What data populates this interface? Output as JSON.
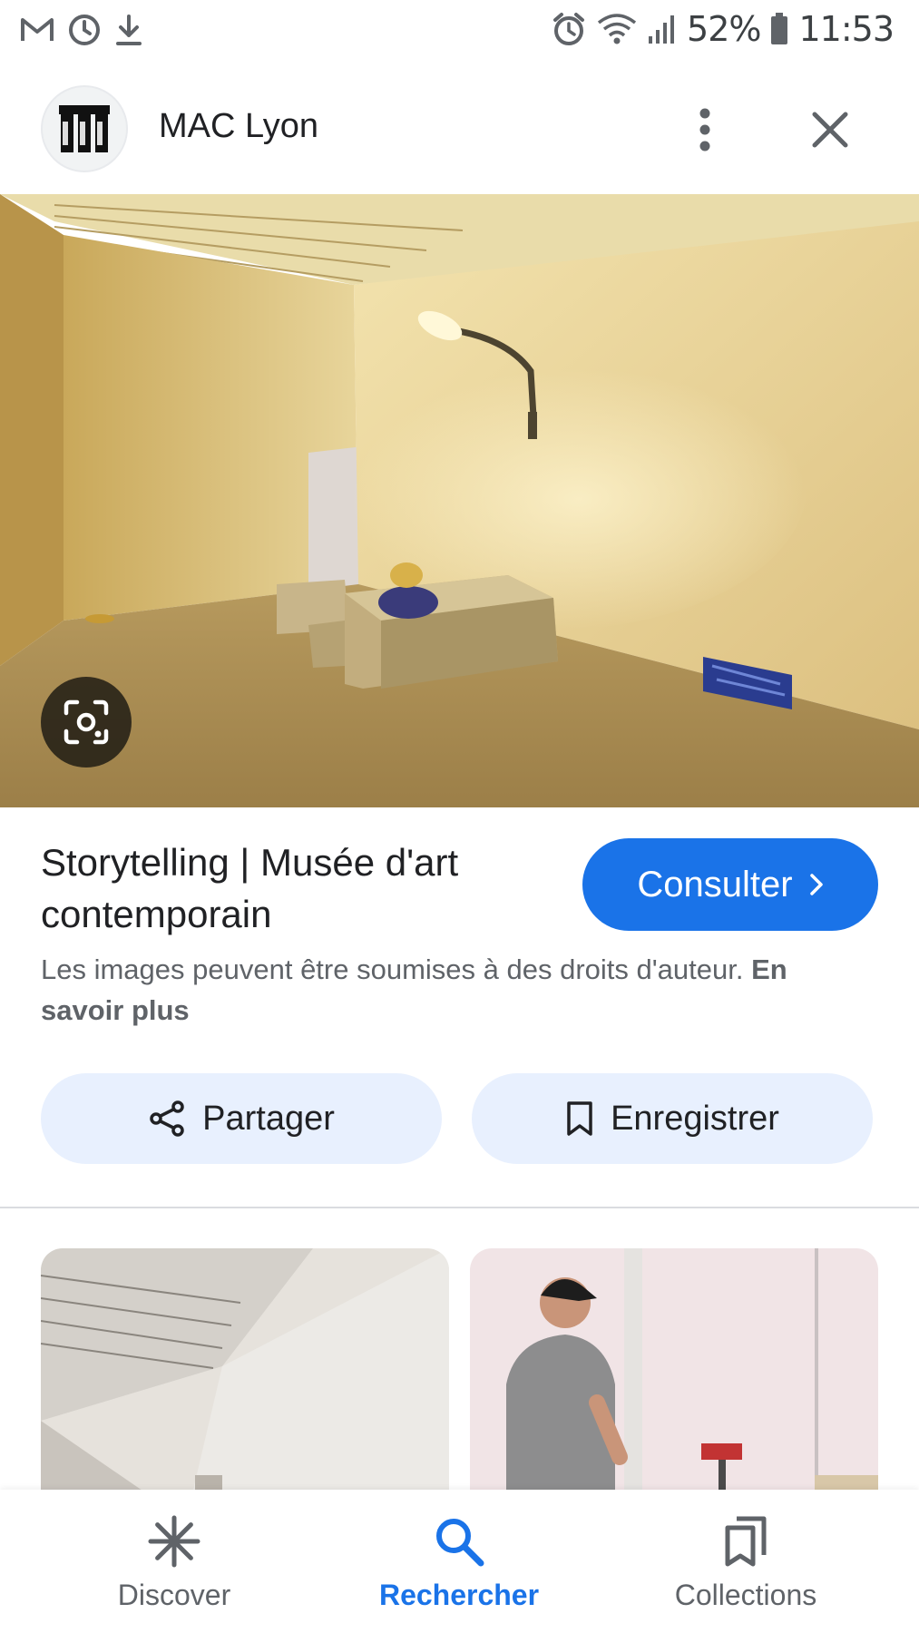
{
  "status_bar": {
    "battery": "52%",
    "time": "11:53",
    "left_icons": [
      "gmail-icon",
      "sync-icon",
      "download-icon"
    ],
    "right_icons": [
      "alarm-icon",
      "wifi-icon",
      "signal-icon",
      "battery-icon"
    ]
  },
  "header": {
    "site_name": "MAC Lyon",
    "icons": [
      "site-logo",
      "more-vert-icon",
      "close-icon"
    ]
  },
  "result": {
    "title": "Storytelling | Musée d'art contemporain",
    "visit_label": "Consulter",
    "copyright_text": "Les images peuvent être soumises à des droits d'auteur.",
    "learn_more": "En savoir plus"
  },
  "actions": {
    "share_label": "Partager",
    "save_label": "Enregistrer"
  },
  "bottom_nav": {
    "items": [
      {
        "label": "Discover",
        "icon": "asterisk-icon"
      },
      {
        "label": "Rechercher",
        "icon": "search-icon",
        "active": true
      },
      {
        "label": "Collections",
        "icon": "collections-icon"
      }
    ]
  },
  "colors": {
    "accent": "#1a73e8",
    "chip_bg": "#e8f0fe",
    "text_primary": "#202124",
    "text_secondary": "#5f6368"
  }
}
